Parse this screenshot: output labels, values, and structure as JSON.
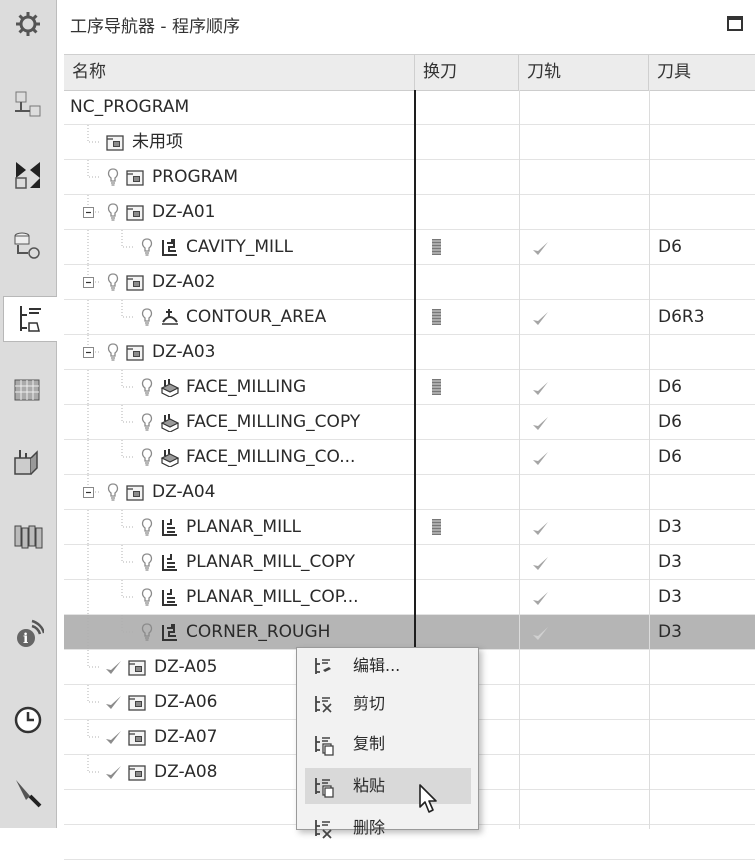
{
  "title": "工序导航器 - 程序顺序",
  "columns": [
    "名称",
    "换刀",
    "刀轨",
    "刀具"
  ],
  "rows": [
    {
      "name": "NC_PROGRAM",
      "level": 0,
      "expander": false,
      "light": false,
      "type": "root",
      "toolchange": false,
      "path": "",
      "tool": ""
    },
    {
      "name": "未用项",
      "level": 1,
      "expander": false,
      "light": false,
      "type": "folder",
      "toolchange": false,
      "path": "",
      "tool": ""
    },
    {
      "name": "PROGRAM",
      "level": 1,
      "expander": false,
      "light": true,
      "type": "folder",
      "toolchange": false,
      "path": "",
      "tool": ""
    },
    {
      "name": "DZ-A01",
      "level": 1,
      "expander": true,
      "light": true,
      "type": "folder",
      "toolchange": false,
      "path": "",
      "tool": ""
    },
    {
      "name": "CAVITY_MILL",
      "level": 2,
      "expander": false,
      "light": true,
      "type": "cavity",
      "toolchange": true,
      "path": "check",
      "tool": "D6"
    },
    {
      "name": "DZ-A02",
      "level": 1,
      "expander": true,
      "light": true,
      "type": "folder",
      "toolchange": false,
      "path": "",
      "tool": ""
    },
    {
      "name": "CONTOUR_AREA",
      "level": 2,
      "expander": false,
      "light": true,
      "type": "contour",
      "toolchange": true,
      "path": "check",
      "tool": "D6R3"
    },
    {
      "name": "DZ-A03",
      "level": 1,
      "expander": true,
      "light": true,
      "type": "folder",
      "toolchange": false,
      "path": "",
      "tool": ""
    },
    {
      "name": "FACE_MILLING",
      "level": 2,
      "expander": false,
      "light": true,
      "type": "face",
      "toolchange": true,
      "path": "check",
      "tool": "D6"
    },
    {
      "name": "FACE_MILLING_COPY",
      "level": 2,
      "expander": false,
      "light": true,
      "type": "face",
      "toolchange": false,
      "path": "check",
      "tool": "D6"
    },
    {
      "name": "FACE_MILLING_CO...",
      "level": 2,
      "expander": false,
      "light": true,
      "type": "face",
      "toolchange": false,
      "path": "check",
      "tool": "D6"
    },
    {
      "name": "DZ-A04",
      "level": 1,
      "expander": true,
      "light": true,
      "type": "folder",
      "toolchange": false,
      "path": "",
      "tool": ""
    },
    {
      "name": "PLANAR_MILL",
      "level": 2,
      "expander": false,
      "light": true,
      "type": "planar",
      "toolchange": true,
      "path": "check",
      "tool": "D3"
    },
    {
      "name": "PLANAR_MILL_COPY",
      "level": 2,
      "expander": false,
      "light": true,
      "type": "planar",
      "toolchange": false,
      "path": "check",
      "tool": "D3"
    },
    {
      "name": "PLANAR_MILL_COP...",
      "level": 2,
      "expander": false,
      "light": true,
      "type": "planar",
      "toolchange": false,
      "path": "check",
      "tool": "D3"
    },
    {
      "name": "CORNER_ROUGH",
      "level": 2,
      "expander": false,
      "light": true,
      "type": "cavity",
      "toolchange": false,
      "path": "check",
      "tool": "D3",
      "selected": true
    },
    {
      "name": "DZ-A05",
      "level": 1,
      "expander": false,
      "light": false,
      "check": true,
      "type": "folder",
      "toolchange": false,
      "path": "",
      "tool": ""
    },
    {
      "name": "DZ-A06",
      "level": 1,
      "expander": false,
      "light": false,
      "check": true,
      "type": "folder",
      "toolchange": false,
      "path": "",
      "tool": ""
    },
    {
      "name": "DZ-A07",
      "level": 1,
      "expander": false,
      "light": false,
      "check": true,
      "type": "folder",
      "toolchange": false,
      "path": "",
      "tool": ""
    },
    {
      "name": "DZ-A08",
      "level": 1,
      "expander": false,
      "light": false,
      "check": true,
      "type": "folder",
      "toolchange": false,
      "path": "",
      "tool": ""
    }
  ],
  "context_menu": [
    {
      "label": "编辑...",
      "icon": "edit-icon"
    },
    {
      "label": "剪切",
      "icon": "cut-icon"
    },
    {
      "label": "复制",
      "icon": "copy-icon"
    },
    {
      "label": "粘贴",
      "icon": "paste-icon",
      "hover": true
    },
    {
      "label": "删除",
      "icon": "delete-icon"
    }
  ],
  "sidebar_icons": [
    "settings-icon",
    "assembly-navigator-icon",
    "constraint-navigator-icon",
    "part-navigator-icon",
    "operation-navigator-icon",
    "machine-tool-navigator-icon",
    "assembly-sequence-icon",
    "reuse-library-icon",
    "info-icon",
    "history-icon",
    "process-icon"
  ],
  "colors": {
    "selected_row": "#b5b5b5",
    "check": "#9a9a9a",
    "separator": "#1e1e1e"
  }
}
